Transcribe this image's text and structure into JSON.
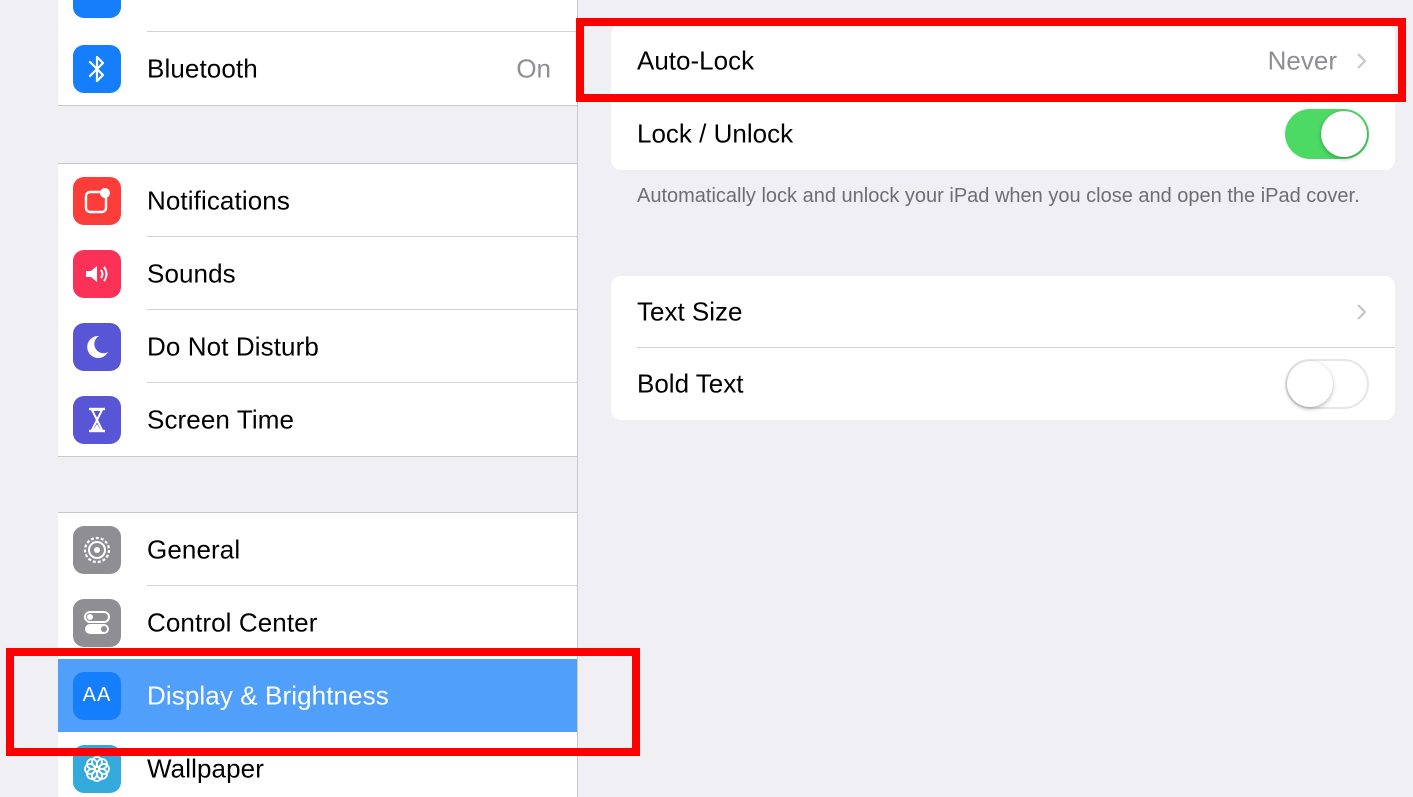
{
  "sidebar": {
    "connectivity": [
      {
        "label": "Bluetooth",
        "value": "On",
        "icon": "bluetooth-icon",
        "color": "#147efb"
      }
    ],
    "alerts": [
      {
        "label": "Notifications",
        "icon": "notifications-icon",
        "color": "#fc3d39"
      },
      {
        "label": "Sounds",
        "icon": "speaker-icon",
        "color": "#fc3158"
      },
      {
        "label": "Do Not Disturb",
        "icon": "moon-icon",
        "color": "#5856d6"
      },
      {
        "label": "Screen Time",
        "icon": "hourglass-icon",
        "color": "#5856d6"
      }
    ],
    "system": [
      {
        "label": "General",
        "icon": "gear-icon",
        "color": "#8e8e93"
      },
      {
        "label": "Control Center",
        "icon": "toggles-icon",
        "color": "#8e8e93"
      },
      {
        "label": "Display & Brightness",
        "icon": "text-size-icon",
        "color": "#147efb",
        "selected": true
      },
      {
        "label": "Wallpaper",
        "icon": "flower-icon",
        "color": "#34aadc"
      }
    ],
    "display_icon_glyph": "AA",
    "selected_color": "#4f9ffb"
  },
  "detail": {
    "lock_group": {
      "auto_lock": {
        "label": "Auto-Lock",
        "value": "Never"
      },
      "lock_unlock": {
        "label": "Lock / Unlock",
        "toggle": "on"
      }
    },
    "lock_footnote": "Automatically lock and unlock your iPad when you close and open the iPad cover.",
    "text_group": {
      "text_size": {
        "label": "Text Size"
      },
      "bold_text": {
        "label": "Bold Text",
        "toggle": "off"
      }
    }
  },
  "colors": {
    "toggle_on": "#4cd964",
    "highlight": "#ff0000",
    "accent": "#147efb"
  }
}
